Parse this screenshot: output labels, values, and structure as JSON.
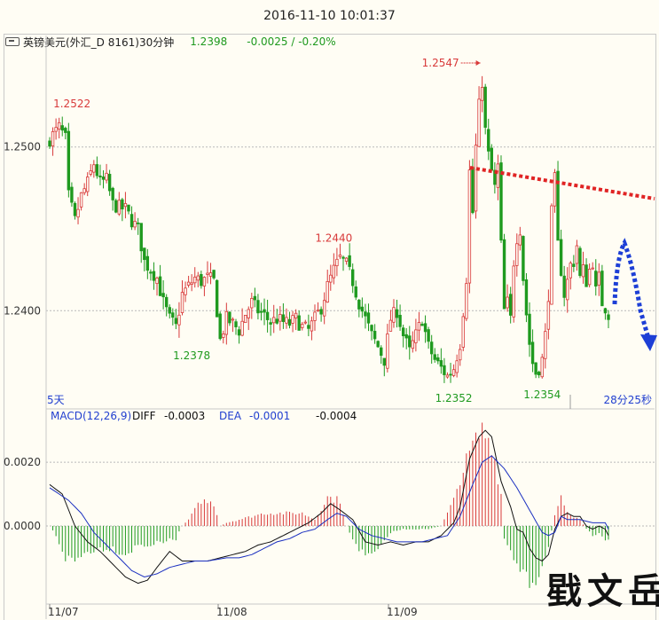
{
  "header": {
    "timestamp": "2016-11-10 10:01:37",
    "symbol_name": "英镑美元(外汇_D 8161)30分钟",
    "last_price": "1.2398",
    "change": "-0.0025 / -0.20%"
  },
  "colors": {
    "up": "#d83a3a",
    "down": "#1f9a1f",
    "diff_line": "#111111",
    "dea_line": "#1a2fc0",
    "trend_line": "#e02424",
    "forecast_arrow": "#1d3fd6",
    "grid": "#b9b9b9",
    "background": "#fffdf4"
  },
  "price_panel": {
    "period_label": "5天",
    "countdown": "28分25秒"
  },
  "macd_panel": {
    "indicator_label": "MACD(12,26,9)",
    "diff_label": "DIFF",
    "diff_value": "-0.0003",
    "dea_label": "DEA",
    "dea_value": "-0.0001",
    "macd_value": "-0.0004"
  },
  "watermark": "戥文岳",
  "chart_data": [
    {
      "type": "candlestick",
      "x_ticks": [
        "11/07",
        "11/08",
        "11/09"
      ],
      "y_ticks": [
        "1.2500",
        "1.2400"
      ],
      "ylim": [
        1.234,
        1.256
      ],
      "grid": true,
      "annotations": [
        {
          "label": "1.2522",
          "value": 1.2522,
          "bar": 2
        },
        {
          "label": "1.2378",
          "value": 1.2378,
          "bar": 45
        },
        {
          "label": "1.2440",
          "value": 1.244,
          "bar": 90
        },
        {
          "label": "1.2352",
          "value": 1.2352,
          "bar": 128
        },
        {
          "label": "1.2547",
          "value": 1.2547,
          "bar": 137
        },
        {
          "label": "1.2354",
          "value": 1.2354,
          "bar": 156
        }
      ],
      "close_path": [
        [
          0,
          1.2505
        ],
        [
          3,
          1.2512
        ],
        [
          5,
          1.2505
        ],
        [
          6,
          1.247
        ],
        [
          8,
          1.2455
        ],
        [
          10,
          1.247
        ],
        [
          12,
          1.2478
        ],
        [
          14,
          1.249
        ],
        [
          16,
          1.2478
        ],
        [
          18,
          1.248
        ],
        [
          20,
          1.2465
        ],
        [
          22,
          1.2463
        ],
        [
          24,
          1.2462
        ],
        [
          26,
          1.2455
        ],
        [
          28,
          1.245
        ],
        [
          30,
          1.243
        ],
        [
          32,
          1.2425
        ],
        [
          34,
          1.242
        ],
        [
          36,
          1.2405
        ],
        [
          38,
          1.2395
        ],
        [
          40,
          1.239
        ],
        [
          42,
          1.241
        ],
        [
          44,
          1.2415
        ],
        [
          46,
          1.242
        ],
        [
          48,
          1.2418
        ],
        [
          50,
          1.242
        ],
        [
          52,
          1.2418
        ],
        [
          54,
          1.2382
        ],
        [
          56,
          1.2395
        ],
        [
          58,
          1.2392
        ],
        [
          60,
          1.2388
        ],
        [
          62,
          1.2398
        ],
        [
          64,
          1.2405
        ],
        [
          66,
          1.24
        ],
        [
          68,
          1.2397
        ],
        [
          70,
          1.2393
        ],
        [
          72,
          1.2395
        ],
        [
          74,
          1.2393
        ],
        [
          76,
          1.2392
        ],
        [
          78,
          1.2395
        ],
        [
          80,
          1.239
        ],
        [
          82,
          1.2388
        ],
        [
          84,
          1.2395
        ],
        [
          86,
          1.2402
        ],
        [
          88,
          1.2415
        ],
        [
          90,
          1.2425
        ],
        [
          92,
          1.2432
        ],
        [
          94,
          1.2428
        ],
        [
          96,
          1.2418
        ],
        [
          98,
          1.2405
        ],
        [
          100,
          1.2395
        ],
        [
          102,
          1.2385
        ],
        [
          104,
          1.2378
        ],
        [
          106,
          1.237
        ],
        [
          108,
          1.2395
        ],
        [
          110,
          1.24
        ],
        [
          112,
          1.2385
        ],
        [
          114,
          1.2375
        ],
        [
          116,
          1.2385
        ],
        [
          118,
          1.2395
        ],
        [
          120,
          1.2378
        ],
        [
          122,
          1.237
        ],
        [
          124,
          1.2365
        ],
        [
          126,
          1.236
        ],
        [
          128,
          1.2365
        ],
        [
          130,
          1.238
        ],
        [
          132,
          1.242
        ],
        [
          133,
          1.2485
        ],
        [
          134,
          1.246
        ],
        [
          135,
          1.25
        ],
        [
          136,
          1.2525
        ],
        [
          137,
          1.254
        ],
        [
          138,
          1.251
        ],
        [
          139,
          1.2495
        ],
        [
          140,
          1.2485
        ],
        [
          141,
          1.2475
        ],
        [
          142,
          1.2488
        ],
        [
          143,
          1.244
        ],
        [
          144,
          1.24
        ],
        [
          145,
          1.2405
        ],
        [
          146,
          1.2395
        ],
        [
          147,
          1.243
        ],
        [
          148,
          1.2445
        ],
        [
          149,
          1.245
        ],
        [
          150,
          1.242
        ],
        [
          151,
          1.2398
        ],
        [
          152,
          1.238
        ],
        [
          153,
          1.2368
        ],
        [
          154,
          1.2362
        ],
        [
          155,
          1.2365
        ],
        [
          156,
          1.237
        ],
        [
          157,
          1.2385
        ],
        [
          158,
          1.241
        ],
        [
          159,
          1.246
        ],
        [
          160,
          1.248
        ],
        [
          161,
          1.244
        ],
        [
          162,
          1.2425
        ],
        [
          163,
          1.241
        ],
        [
          164,
          1.2418
        ],
        [
          165,
          1.2428
        ],
        [
          166,
          1.243
        ],
        [
          167,
          1.244
        ],
        [
          168,
          1.242
        ],
        [
          169,
          1.2425
        ],
        [
          170,
          1.2418
        ],
        [
          171,
          1.2425
        ],
        [
          172,
          1.243
        ],
        [
          173,
          1.2412
        ],
        [
          174,
          1.242
        ],
        [
          175,
          1.2405
        ],
        [
          176,
          1.2402
        ],
        [
          177,
          1.2398
        ]
      ]
    },
    {
      "type": "bar+line",
      "name": "MACD(12,26,9)",
      "y_ticks": [
        "0.0020",
        "0.0000"
      ],
      "ylim": [
        -0.00245,
        0.0032
      ],
      "grid": true,
      "hist_path": [
        [
          0,
          0
        ],
        [
          2,
          -0.0003
        ],
        [
          5,
          -0.001
        ],
        [
          8,
          -0.0011
        ],
        [
          12,
          -0.0008
        ],
        [
          16,
          -0.0007
        ],
        [
          20,
          -0.0007
        ],
        [
          24,
          -0.0009
        ],
        [
          28,
          -0.0006
        ],
        [
          32,
          -0.0006
        ],
        [
          36,
          -0.0005
        ],
        [
          40,
          -0.0004
        ],
        [
          42,
          0
        ],
        [
          44,
          0.0002
        ],
        [
          48,
          0.0008
        ],
        [
          52,
          0.0007
        ],
        [
          54,
          0
        ],
        [
          56,
          0.0001
        ],
        [
          60,
          0.0002
        ],
        [
          64,
          0.0003
        ],
        [
          68,
          0.0004
        ],
        [
          72,
          0.0004
        ],
        [
          76,
          0.0004
        ],
        [
          80,
          0.0004
        ],
        [
          84,
          0.0002
        ],
        [
          88,
          0.0009
        ],
        [
          92,
          0.0008
        ],
        [
          94,
          0
        ],
        [
          96,
          -0.0004
        ],
        [
          100,
          -0.001
        ],
        [
          104,
          -0.0008
        ],
        [
          108,
          -0.0002
        ],
        [
          112,
          -0.0001
        ],
        [
          116,
          -0.0001
        ],
        [
          120,
          -0.0001
        ],
        [
          124,
          0
        ],
        [
          128,
          0.0008
        ],
        [
          130,
          0.0015
        ],
        [
          134,
          0.0025
        ],
        [
          137,
          0.003
        ],
        [
          140,
          0.0026
        ],
        [
          143,
          0.001
        ],
        [
          144,
          -0.0004
        ],
        [
          148,
          -0.0013
        ],
        [
          152,
          -0.0018
        ],
        [
          154,
          -0.0017
        ],
        [
          156,
          -0.0012
        ],
        [
          158,
          -0.0006
        ],
        [
          160,
          0.0003
        ],
        [
          162,
          0.001
        ],
        [
          164,
          0.0005
        ],
        [
          166,
          0.0003
        ],
        [
          168,
          0.0002
        ],
        [
          170,
          -0.0001
        ],
        [
          172,
          -0.0003
        ],
        [
          174,
          -0.0002
        ],
        [
          176,
          -0.0004
        ],
        [
          177,
          -0.0004
        ]
      ],
      "diff_path": [
        [
          0,
          0.0013
        ],
        [
          4,
          0.001
        ],
        [
          8,
          0
        ],
        [
          12,
          -0.0005
        ],
        [
          16,
          -0.0008
        ],
        [
          20,
          -0.0012
        ],
        [
          24,
          -0.0016
        ],
        [
          28,
          -0.0018
        ],
        [
          31,
          -0.0017
        ],
        [
          34,
          -0.0013
        ],
        [
          38,
          -0.0008
        ],
        [
          42,
          -0.0011
        ],
        [
          46,
          -0.0011
        ],
        [
          50,
          -0.0011
        ],
        [
          54,
          -0.001
        ],
        [
          58,
          -0.0009
        ],
        [
          62,
          -0.0008
        ],
        [
          66,
          -0.0006
        ],
        [
          70,
          -0.0005
        ],
        [
          74,
          -0.0003
        ],
        [
          78,
          -0.0001
        ],
        [
          82,
          0.0001
        ],
        [
          86,
          0.0004
        ],
        [
          89,
          0.0007
        ],
        [
          92,
          0.0005
        ],
        [
          96,
          0.0002
        ],
        [
          100,
          -0.0005
        ],
        [
          104,
          -0.0006
        ],
        [
          108,
          -0.0005
        ],
        [
          112,
          -0.0006
        ],
        [
          116,
          -0.0005
        ],
        [
          120,
          -0.0005
        ],
        [
          124,
          -0.0003
        ],
        [
          128,
          0.0001
        ],
        [
          130,
          0.0006
        ],
        [
          133,
          0.0021
        ],
        [
          136,
          0.0028
        ],
        [
          138,
          0.003
        ],
        [
          140,
          0.0028
        ],
        [
          143,
          0.0014
        ],
        [
          146,
          0.0006
        ],
        [
          148,
          -0.0001
        ],
        [
          150,
          -0.0002
        ],
        [
          152,
          -0.0007
        ],
        [
          154,
          -0.001
        ],
        [
          156,
          -0.0011
        ],
        [
          158,
          -0.0009
        ],
        [
          160,
          -0.0001
        ],
        [
          162,
          0.0003
        ],
        [
          164,
          0.0004
        ],
        [
          166,
          0.0003
        ],
        [
          168,
          0.0003
        ],
        [
          170,
          0
        ],
        [
          172,
          -0.0001
        ],
        [
          174,
          0
        ],
        [
          176,
          -0.0001
        ],
        [
          177,
          -0.0003
        ]
      ],
      "dea_path": [
        [
          0,
          0.0012
        ],
        [
          6,
          0.0008
        ],
        [
          10,
          0.0004
        ],
        [
          14,
          -0.0002
        ],
        [
          18,
          -0.0006
        ],
        [
          22,
          -0.001
        ],
        [
          26,
          -0.0014
        ],
        [
          30,
          -0.0016
        ],
        [
          34,
          -0.0015
        ],
        [
          38,
          -0.0013
        ],
        [
          42,
          -0.0012
        ],
        [
          46,
          -0.0011
        ],
        [
          50,
          -0.0011
        ],
        [
          56,
          -0.001
        ],
        [
          60,
          -0.001
        ],
        [
          64,
          -0.0009
        ],
        [
          68,
          -0.0007
        ],
        [
          72,
          -0.0005
        ],
        [
          76,
          -0.0004
        ],
        [
          80,
          -0.0002
        ],
        [
          84,
          -0.0001
        ],
        [
          88,
          0.0002
        ],
        [
          91,
          0.0004
        ],
        [
          94,
          0.0003
        ],
        [
          98,
          -0.0001
        ],
        [
          102,
          -0.0003
        ],
        [
          106,
          -0.0004
        ],
        [
          110,
          -0.0005
        ],
        [
          114,
          -0.0005
        ],
        [
          118,
          -0.0005
        ],
        [
          122,
          -0.0004
        ],
        [
          126,
          -0.0003
        ],
        [
          130,
          0.0003
        ],
        [
          134,
          0.0013
        ],
        [
          137,
          0.002
        ],
        [
          140,
          0.0022
        ],
        [
          144,
          0.0018
        ],
        [
          148,
          0.0012
        ],
        [
          152,
          0.0005
        ],
        [
          156,
          -0.0002
        ],
        [
          158,
          -0.0003
        ],
        [
          160,
          -0.0002
        ],
        [
          162,
          0.0003
        ],
        [
          164,
          0.0002
        ],
        [
          168,
          0.0002
        ],
        [
          172,
          0.0001
        ],
        [
          176,
          0.0001
        ],
        [
          177,
          -0.0001
        ]
      ]
    }
  ]
}
